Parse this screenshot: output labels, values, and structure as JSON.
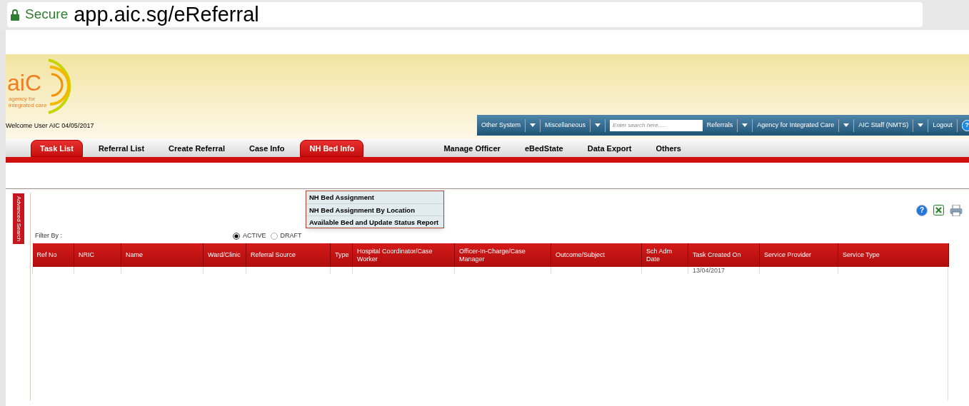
{
  "browser": {
    "secure_label": "Secure",
    "url": "app.aic.sg/eReferral"
  },
  "header": {
    "logo_text": "aiC",
    "logo_tagline_1": "agency for",
    "logo_tagline_2": "integrated care",
    "welcome": "Welcome User AIC 04/05/2017"
  },
  "toolbar": {
    "items": [
      {
        "kind": "menu",
        "label": "Other System"
      },
      {
        "kind": "menu",
        "label": "Miscellaneous"
      },
      {
        "kind": "search",
        "placeholder": "Enter search here....."
      },
      {
        "kind": "menu",
        "label": "Referrals"
      },
      {
        "kind": "menu",
        "label": "Agency for Integrated Care"
      },
      {
        "kind": "menu",
        "label": "AIC Staff (NMTS)"
      },
      {
        "kind": "link",
        "label": "Logout"
      },
      {
        "kind": "help",
        "label": "?"
      }
    ]
  },
  "nav": {
    "tabs": [
      {
        "label": "Task List",
        "highlighted": true
      },
      {
        "label": "Referral List",
        "highlighted": false
      },
      {
        "label": "Create Referral",
        "highlighted": false
      },
      {
        "label": "Case Info",
        "highlighted": false
      },
      {
        "label": "NH Bed Info",
        "highlighted": true
      },
      {
        "label": "Manage Officer",
        "highlighted": false
      },
      {
        "label": "eBedState",
        "highlighted": false
      },
      {
        "label": "Data Export",
        "highlighted": false
      },
      {
        "label": "Others",
        "highlighted": false
      }
    ],
    "dropdown": {
      "items": [
        "NH Bed Assignment",
        "NH Bed Assignment By Location",
        "Available Bed and Update Status Report"
      ]
    }
  },
  "side_tab": "Advanced Search",
  "page_tools": {
    "help_label": "?"
  },
  "filter": {
    "label": "Filter By :",
    "options": [
      {
        "label": "ACTIVE",
        "selected": true
      },
      {
        "label": "DRAFT",
        "selected": false
      }
    ]
  },
  "table": {
    "columns": [
      "Ref No",
      "NRIC",
      "Name",
      "Ward/Clinic",
      "Referral Source",
      "Type",
      "Hospital Coordinator/Case Worker",
      "Officer-In-Charge/Case Manager",
      "Outcome/Subject",
      "Sch Adm Date",
      "Task Created On",
      "Service Provider",
      "Service Type"
    ],
    "rows": [
      [
        "",
        "",
        "",
        "",
        "",
        "",
        "",
        "",
        "",
        "",
        "13/04/2017",
        "",
        ""
      ]
    ]
  }
}
